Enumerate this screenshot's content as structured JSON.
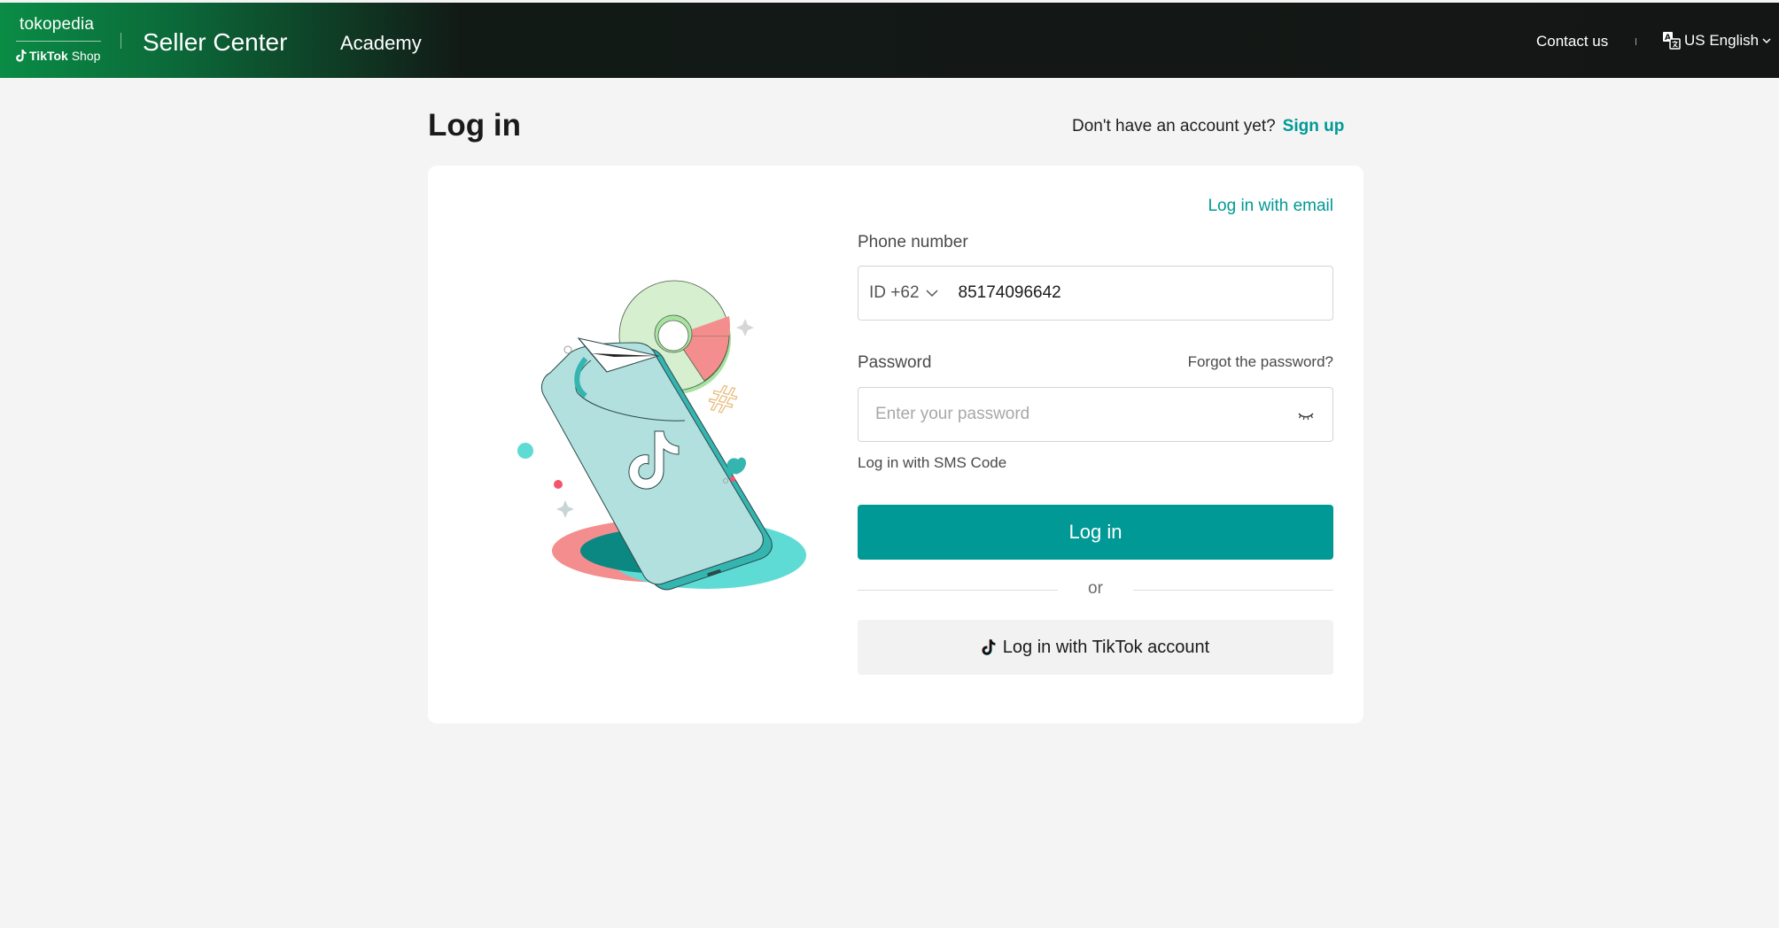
{
  "header": {
    "brand_tokopedia": "tokopedia",
    "brand_tiktok": "TikTok",
    "brand_shop": "Shop",
    "app_title": "Seller Center",
    "nav_academy": "Academy",
    "contact_us": "Contact us",
    "language": "US English"
  },
  "page": {
    "title": "Log in",
    "no_account_text": "Don't have an account yet?",
    "signup_label": "Sign up"
  },
  "form": {
    "email_login_link": "Log in with email",
    "phone_label": "Phone number",
    "country_code": "ID +62",
    "phone_value": "85174096642",
    "password_label": "Password",
    "forgot_password": "Forgot the password?",
    "password_placeholder": "Enter your password",
    "sms_login": "Log in with SMS Code",
    "login_button": "Log in",
    "or_text": "or",
    "tiktok_login_button": "Log in with TikTok account"
  },
  "icons": {
    "language": "translate-icon",
    "dropdown": "chevron-down-icon",
    "password_visibility": "eye-closed-icon",
    "tiktok": "tiktok-logo-icon"
  },
  "colors": {
    "accent": "#009995",
    "header_green": "#0a8c45",
    "header_dark": "#141615",
    "background": "#f4f4f4"
  }
}
